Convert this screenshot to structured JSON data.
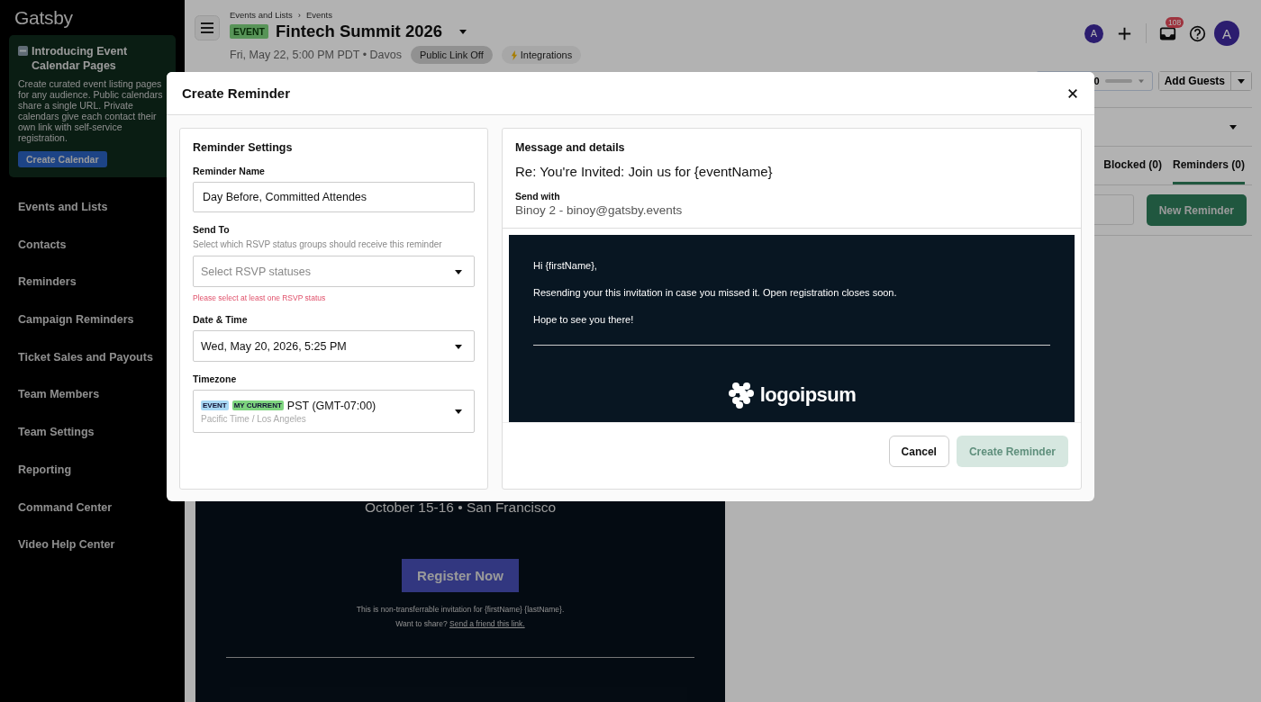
{
  "sidebar": {
    "logo": "Gatsby",
    "promo": {
      "title": "Introducing Event Calendar Pages",
      "text": "Create curated event listing pages for any audience. Public calendars share a single URL. Private calendars give each contact their own link with self-service registration.",
      "button": "Create Calendar"
    },
    "items": [
      {
        "label": "Events and Lists"
      },
      {
        "label": "Contacts"
      },
      {
        "label": "Reminders"
      },
      {
        "label": "Campaign Reminders"
      },
      {
        "label": "Ticket Sales and Payouts"
      },
      {
        "label": "Team Members"
      },
      {
        "label": "Team Settings"
      },
      {
        "label": "Reporting"
      },
      {
        "label": "Command Center"
      },
      {
        "label": "Video Help Center"
      }
    ]
  },
  "header": {
    "breadcrumbs": [
      "Events and Lists",
      "Events"
    ],
    "separator": "›",
    "event_tag": "EVENT",
    "title": "Fintech Summit 2026",
    "meta": "Fri, May 22, 5:00 PM PDT • Davos",
    "public_link": "Public Link Off",
    "integrations": "Integrations",
    "small_avatar": "A",
    "notification_count": "108",
    "profile_avatar": "A"
  },
  "toolbar": {
    "partial_value": "0",
    "add_guests": "Add Guests"
  },
  "tabs": [
    {
      "label": "Blocked (0)",
      "selected": false
    },
    {
      "label": "Reminders (0)",
      "selected": true
    }
  ],
  "new_reminder": "New Reminder",
  "email_preview": {
    "date_line": "October 15-16 • San Francisco",
    "button": "Register Now",
    "notice": "This is non-transferrable invitation for {firstName} {lastName}.",
    "share": "Want to share?",
    "share_link": "Send a friend this link."
  },
  "modal": {
    "title": "Create Reminder",
    "settings": {
      "heading": "Reminder Settings",
      "name": {
        "label": "Reminder Name",
        "value": "Day Before, Committed Attendes"
      },
      "send_to": {
        "label": "Send To",
        "help": "Select which RSVP status groups should receive this reminder",
        "placeholder": "Select RSVP statuses",
        "error": "Please select at least one RSVP status"
      },
      "date_time": {
        "label": "Date & Time",
        "value": "Wed, May 20, 2026, 5:25 PM"
      },
      "timezone": {
        "label": "Timezone",
        "tags": [
          {
            "label": "EVENT",
            "color": "#a8d8f4"
          },
          {
            "label": "MY CURRENT",
            "color": "#7ed47e"
          }
        ],
        "value": "PST (GMT-07:00)",
        "subtext": "Pacific Time / Los Angeles"
      }
    },
    "message": {
      "heading": "Message and details",
      "subject": "Re: You're Invited: Join us for {eventName}",
      "send_with_label": "Send with",
      "sender": "Binoy 2 - binoy@gatsby.events",
      "body": [
        "Hi {firstName},",
        "Resending your this invitation in case you missed it. Open registration closes soon.",
        "Hope to see you there!"
      ],
      "logo_text": "logoipsum"
    },
    "buttons": [
      {
        "label": "Cancel",
        "kind": "secondary",
        "disabled": false
      },
      {
        "label": "Create Reminder",
        "kind": "primary",
        "disabled": true
      }
    ]
  }
}
